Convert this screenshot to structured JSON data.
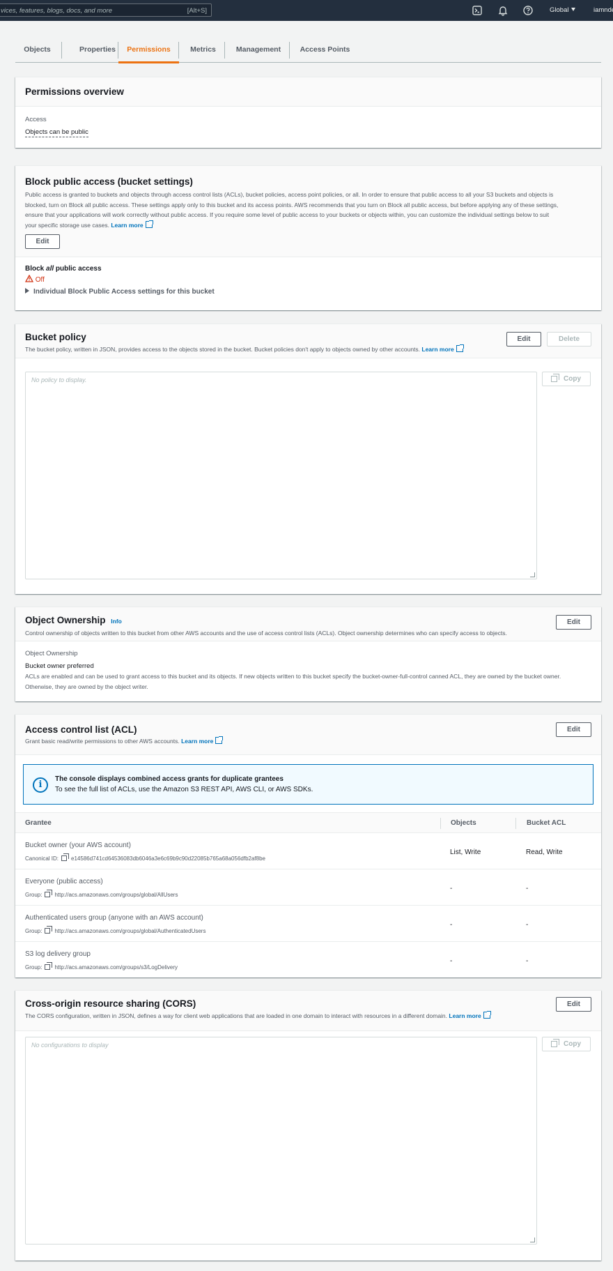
{
  "topbar": {
    "search_placeholder": "vices, features, blogs, docs, and more",
    "search_shortcut": "[Alt+S]",
    "region": "Global",
    "user": "iamnde"
  },
  "tabs": [
    {
      "label": "Objects"
    },
    {
      "label": "Properties"
    },
    {
      "label": "Permissions",
      "active": true
    },
    {
      "label": "Metrics"
    },
    {
      "label": "Management"
    },
    {
      "label": "Access Points"
    }
  ],
  "permissions_overview": {
    "title": "Permissions overview",
    "access_label": "Access",
    "access_value": "Objects can be public"
  },
  "block_public_access": {
    "title": "Block public access (bucket settings)",
    "desc_lines": [
      "Public access is granted to buckets and objects through access control lists (ACLs), bucket policies, access point policies, or all. In order to ensure that public access to all your S3 buckets and objects is",
      "blocked, turn on Block all public access. These settings apply only to this bucket and its access points. AWS recommends that you turn on Block all public access, but before applying any of these settings,",
      "ensure that your applications will work correctly without public access. If you require some level of public access to your buckets or objects within, you can customize the individual settings below to suit",
      "your specific storage use cases."
    ],
    "learn_more": "Learn more",
    "edit_label": "Edit",
    "block_all_prefix": "Block ",
    "block_all_emph": "all",
    "block_all_suffix": " public access",
    "status": "Off",
    "status_color": "#d13212",
    "expander": "Individual Block Public Access settings for this bucket"
  },
  "bucket_policy": {
    "title": "Bucket policy",
    "desc": "The bucket policy, written in JSON, provides access to the objects stored in the bucket. Bucket policies don't apply to objects owned by other accounts.",
    "learn_more": "Learn more",
    "edit_label": "Edit",
    "delete_label": "Delete",
    "placeholder": "No policy to display.",
    "copy_label": "Copy"
  },
  "object_ownership": {
    "title": "Object Ownership",
    "info": "Info",
    "desc": "Control ownership of objects written to this bucket from other AWS accounts and the use of access control lists (ACLs). Object ownership determines who can specify access to objects.",
    "edit_label": "Edit",
    "field_label": "Object Ownership",
    "value": "Bucket owner preferred",
    "detail_lines": [
      "ACLs are enabled and can be used to grant access to this bucket and its objects. If new objects written to this bucket specify the bucket-owner-full-control canned ACL, they are owned by the bucket owner.",
      "Otherwise, they are owned by the object writer."
    ]
  },
  "acl": {
    "title": "Access control list (ACL)",
    "desc": "Grant basic read/write permissions to other AWS accounts.",
    "learn_more": "Learn more",
    "edit_label": "Edit",
    "alert_title": "The console displays combined access grants for duplicate grantees",
    "alert_body": "To see the full list of ACLs, use the Amazon S3 REST API, AWS CLI, or AWS SDKs.",
    "columns": [
      "Grantee",
      "Objects",
      "Bucket ACL"
    ],
    "rows": [
      {
        "grantee": "Bucket owner (your AWS account)",
        "id_label": "Canonical ID:",
        "id_value": "e14586d741cd64536083db6046a3e6c69b9c90d22085b765a68a056dfb2af8be",
        "objects": "List, Write",
        "bucket_acl": "Read, Write"
      },
      {
        "grantee": "Everyone (public access)",
        "id_label": "Group:",
        "id_value": "http://acs.amazonaws.com/groups/global/AllUsers",
        "objects": "-",
        "bucket_acl": "-"
      },
      {
        "grantee": "Authenticated users group (anyone with an AWS account)",
        "id_label": "Group:",
        "id_value": "http://acs.amazonaws.com/groups/global/AuthenticatedUsers",
        "objects": "-",
        "bucket_acl": "-"
      },
      {
        "grantee": "S3 log delivery group",
        "id_label": "Group:",
        "id_value": "http://acs.amazonaws.com/groups/s3/LogDelivery",
        "objects": "-",
        "bucket_acl": "-"
      }
    ]
  },
  "cors": {
    "title": "Cross-origin resource sharing (CORS)",
    "desc": "The CORS configuration, written in JSON, defines a way for client web applications that are loaded in one domain to interact with resources in a different domain.",
    "learn_more": "Learn more",
    "edit_label": "Edit",
    "placeholder": "No configurations to display",
    "copy_label": "Copy"
  }
}
